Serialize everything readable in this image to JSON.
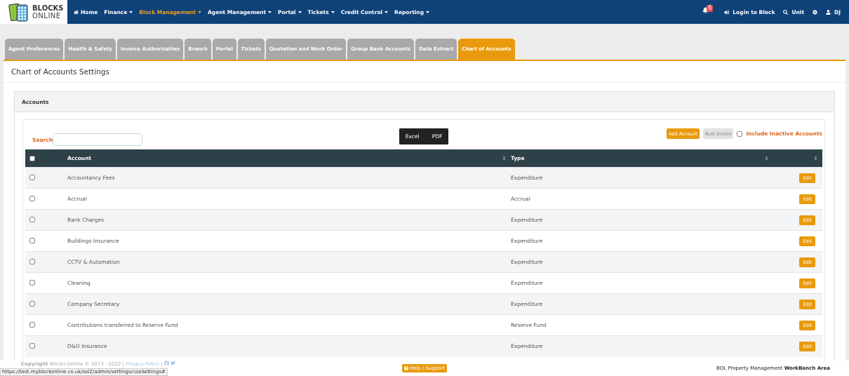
{
  "brand": {
    "line_1": "BLOCKS",
    "line_2": "ONLINE"
  },
  "nav": {
    "items": [
      {
        "label": "Home",
        "kind": "home",
        "selected": false
      },
      {
        "label": "Finance",
        "kind": "menu",
        "selected": false
      },
      {
        "label": "Block Management",
        "kind": "menu",
        "selected": true
      },
      {
        "label": "Agent Management",
        "kind": "menu",
        "selected": false
      },
      {
        "label": "Portal",
        "kind": "menu",
        "selected": false
      },
      {
        "label": "Tickets",
        "kind": "menu",
        "selected": false
      },
      {
        "label": "Credit Control",
        "kind": "menu",
        "selected": false
      },
      {
        "label": "Reporting",
        "kind": "menu",
        "selected": false
      }
    ],
    "notifications": "6",
    "right": [
      {
        "kind": "login",
        "label": "Login to Block"
      },
      {
        "kind": "search",
        "label": "Unit"
      },
      {
        "kind": "settings"
      },
      {
        "kind": "user",
        "label": "DJ"
      }
    ]
  },
  "tabs": [
    {
      "label": "Agent Preferences",
      "selected": false
    },
    {
      "label": "Health & Safety",
      "selected": false
    },
    {
      "label": "Invoice Authorisation",
      "selected": false
    },
    {
      "label": "Branch",
      "selected": false
    },
    {
      "label": "Portal",
      "selected": false
    },
    {
      "label": "Tickets",
      "selected": false
    },
    {
      "label": "Quotation and Work Order",
      "selected": false
    },
    {
      "label": "Group Bank Accounts",
      "selected": false
    },
    {
      "label": "Data Extract",
      "selected": false
    },
    {
      "label": "Chart of Accounts",
      "selected": true
    }
  ],
  "page_title": "Chart of Accounts Settings",
  "panel_title": "Accounts",
  "search": {
    "label": "Search"
  },
  "export_buttons": [
    "Excel",
    "PDF"
  ],
  "add_button": "Add Account",
  "bulk_delete": {
    "label": "Bulk Delete",
    "disabled": true
  },
  "include_inactive": {
    "label": "Include Inactive Accounts",
    "checked": false
  },
  "table": {
    "select_all": false,
    "columns": [
      "Account",
      "Type"
    ],
    "rows": [
      {
        "account": "Accountancy Fees",
        "type": "Expenditure",
        "checked": false,
        "action": "Edit"
      },
      {
        "account": "Accrual",
        "type": "Accrual",
        "checked": false,
        "action": "Edit"
      },
      {
        "account": "Bank Charges",
        "type": "Expenditure",
        "checked": false,
        "action": "Edit"
      },
      {
        "account": "Buildings Insurance",
        "type": "Expenditure",
        "checked": false,
        "action": "Edit"
      },
      {
        "account": "CCTV & Automation",
        "type": "Expenditure",
        "checked": false,
        "action": "Edit"
      },
      {
        "account": "Cleaning",
        "type": "Expenditure",
        "checked": false,
        "action": "Edit"
      },
      {
        "account": "Company Secretary",
        "type": "Expenditure",
        "checked": false,
        "action": "Edit"
      },
      {
        "account": "Contributions transferred to Reserve Fund",
        "type": "Reserve Fund",
        "checked": false,
        "action": "Edit"
      },
      {
        "account": "D&O Insurance",
        "type": "Expenditure",
        "checked": false,
        "action": "Edit"
      }
    ]
  },
  "footer": {
    "copyright_bold": "Copyright",
    "copyright": "Blocks Online © 2013 - 2022 |",
    "privacy": "Privacy Policy",
    "separator": "|",
    "help": "Help / Support",
    "right_prefix": "BOL Property Management",
    "right_bold": "WorkBench Area"
  },
  "status_url": "https://test.myblockonline.co.uk/sol2/admin/settings/coaSettings#"
}
